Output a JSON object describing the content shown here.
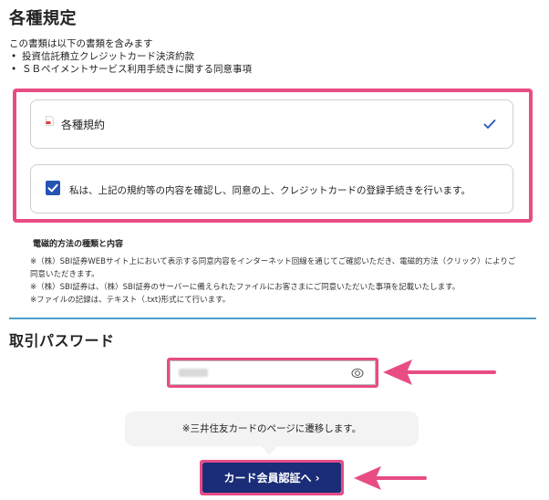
{
  "section_terms": {
    "title": "各種規定",
    "intro": "この書類は以下の書類を含みます",
    "bullets": [
      "投資信託積立クレジットカード決済約款",
      "ＳＢペイメントサービス利用手続きに関する同意事項"
    ],
    "document_card": {
      "label": "各種規約",
      "icon": "pdf-icon",
      "state_icon": "checkmark-icon"
    },
    "agreement": {
      "checked": true,
      "label": "私は、上記の規約等の内容を確認し、同意の上、クレジットカードの登録手続きを行います。"
    }
  },
  "electronic_notice": {
    "title": "電磁的方法の種類と内容",
    "lines": [
      "※（株）SBI証券WEBサイト上において表示する同意内容をインターネット回線を通じてご確認いただき、電磁的方法（クリック）によりご同意いただきます。",
      "※（株）SBI証券は、（株）SBI証券のサーバーに備えられたファイルにお客さまにご同意いただいた事項を記載いたします。",
      "※ファイルの記録は、テキスト（.txt)形式にて行います。"
    ]
  },
  "password": {
    "title": "取引パスワード",
    "value": "",
    "eye_icon": "eye-icon"
  },
  "tooltip": {
    "text": "※三井住友カードのページに遷移します。"
  },
  "submit_button": {
    "label": "カード会員認証へ ›"
  },
  "colors": {
    "highlight": "#e84c84",
    "checkbox": "#2455b2",
    "button": "#1b2d78",
    "divider": "#4aa0cc"
  }
}
